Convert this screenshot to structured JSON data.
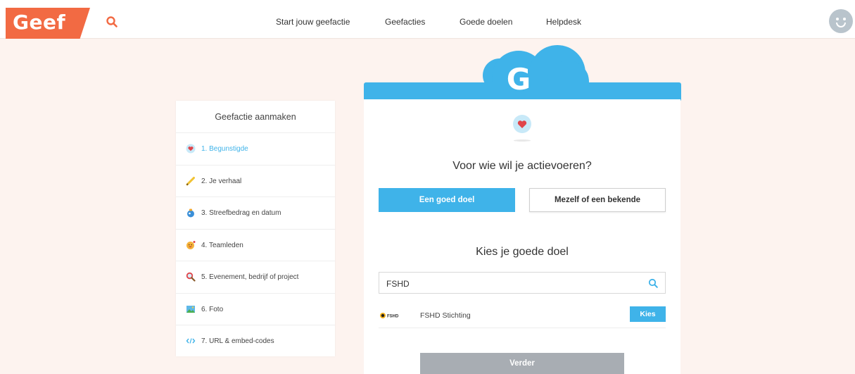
{
  "header": {
    "logo": "Geef",
    "nav": [
      "Start jouw geefactie",
      "Geefacties",
      "Goede doelen",
      "Helpdesk"
    ]
  },
  "sidebar": {
    "title": "Geefactie aanmaken",
    "items": [
      {
        "label": "1. Begunstigde",
        "icon": "heart-icon",
        "active": true
      },
      {
        "label": "2. Je verhaal",
        "icon": "pencil-icon",
        "active": false
      },
      {
        "label": "3. Streefbedrag en datum",
        "icon": "moneybag-icon",
        "active": false
      },
      {
        "label": "4. Teamleden",
        "icon": "smiley-icon",
        "active": false
      },
      {
        "label": "5. Evenement, bedrijf of project",
        "icon": "magnifier-icon",
        "active": false
      },
      {
        "label": "6. Foto",
        "icon": "picture-icon",
        "active": false
      },
      {
        "label": "7. URL & embed-codes",
        "icon": "code-icon",
        "active": false
      }
    ]
  },
  "main": {
    "cloud_letter": "G",
    "question1": "Voor wie wil je actievoeren?",
    "option_primary": "Een goed doel",
    "option_secondary": "Mezelf of een bekende",
    "question2": "Kies je goede doel",
    "search_value": "FSHD",
    "result": {
      "logo_text": "FSHD",
      "name": "FSHD Stichting",
      "button": "Kies"
    },
    "next_button": "Verder"
  },
  "colors": {
    "brand_orange": "#f26a43",
    "accent_blue": "#3fb3e9",
    "page_bg": "#fdf3ef",
    "disabled_gray": "#a8adb3"
  }
}
